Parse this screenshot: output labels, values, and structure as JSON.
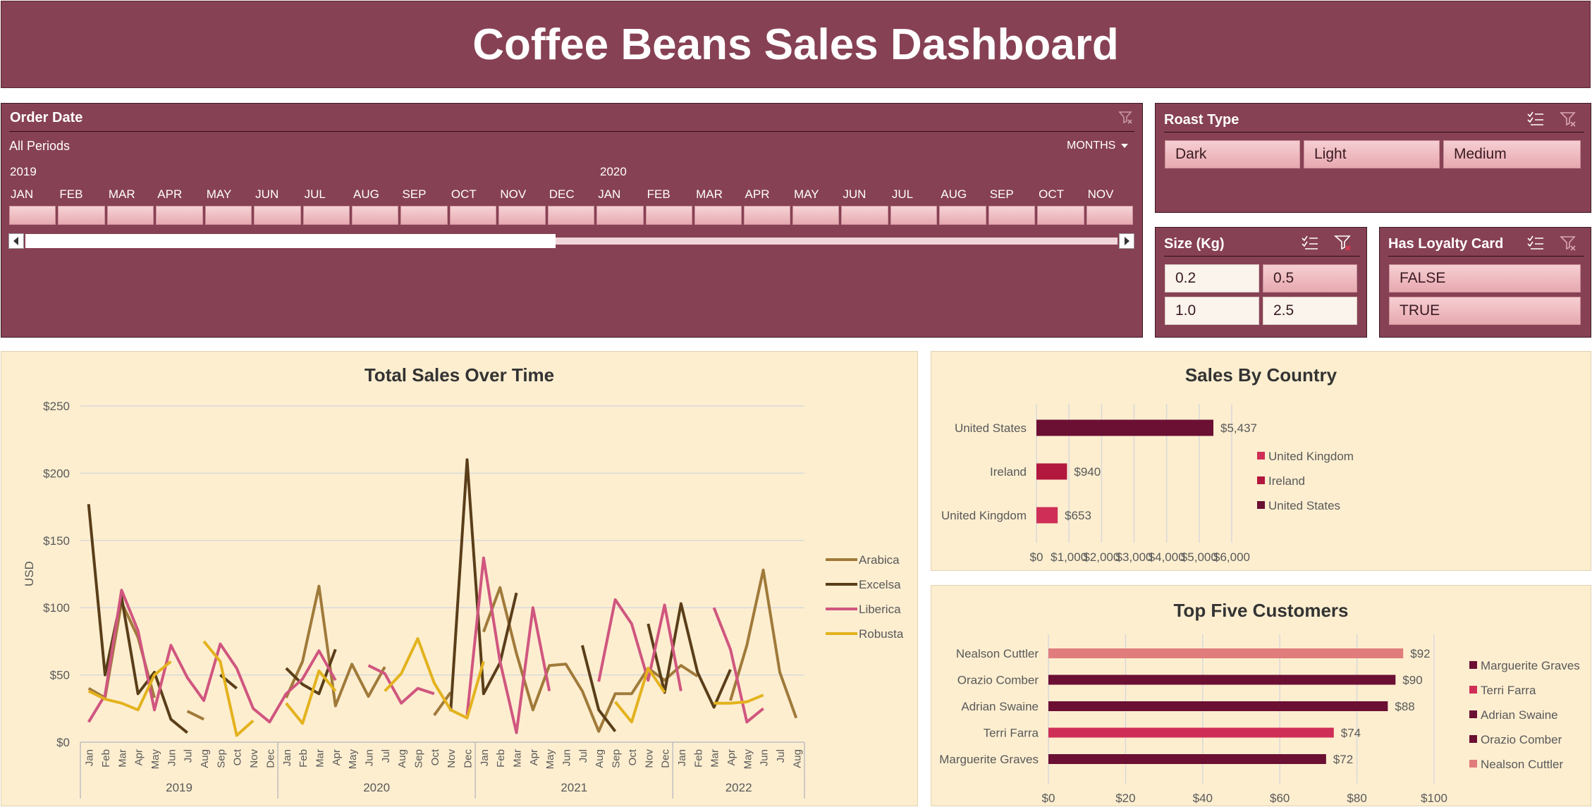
{
  "header": {
    "title": "Coffee Beans Sales Dashboard"
  },
  "timeline": {
    "title": "Order Date",
    "period_text": "All Periods",
    "level": "MONTHS",
    "years": [
      "2019",
      "2020"
    ],
    "months": [
      "JAN",
      "FEB",
      "MAR",
      "APR",
      "MAY",
      "JUN",
      "JUL",
      "AUG",
      "SEP",
      "OCT",
      "NOV",
      "DEC",
      "JAN",
      "FEB",
      "MAR",
      "APR",
      "MAY",
      "JUN",
      "JUL",
      "AUG",
      "SEP",
      "OCT",
      "NOV"
    ],
    "icon": "filter-clear-icon"
  },
  "roast": {
    "title": "Roast Type",
    "items": [
      "Dark",
      "Light",
      "Medium"
    ]
  },
  "size": {
    "title": "Size (Kg)",
    "items": [
      "0.2",
      "0.5",
      "1.0",
      "2.5"
    ]
  },
  "loyalty": {
    "title": "Has Loyalty Card",
    "items": [
      "FALSE",
      "TRUE"
    ]
  },
  "line_chart": {
    "title": "Total Sales Over Time",
    "ylabel": "USD",
    "yticks": [
      "$0",
      "$50",
      "$100",
      "$150",
      "$200",
      "$250"
    ],
    "year_labels": [
      "2019",
      "2020",
      "2021",
      "2022"
    ],
    "month_labels": [
      "Jan",
      "Feb",
      "Mar",
      "Apr",
      "May",
      "Jun",
      "Jul",
      "Aug",
      "Sep",
      "Oct",
      "Nov",
      "Dec"
    ],
    "last_year_months": 8
  },
  "country_chart": {
    "title": "Sales By Country",
    "categories": [
      "United States",
      "Ireland",
      "United Kingdom"
    ],
    "values": [
      5437,
      940,
      653
    ],
    "labels": [
      "$5,437",
      "$940",
      "$653"
    ],
    "colors": [
      "#6b0f33",
      "#b2173e",
      "#cf2f56"
    ],
    "xticks": [
      "$0",
      "$1,000",
      "$2,000",
      "$3,000",
      "$4,000",
      "$5,000",
      "$6,000"
    ],
    "legend": [
      "United Kingdom",
      "Ireland",
      "United States"
    ],
    "legend_colors": [
      "#cf2f56",
      "#b2173e",
      "#6b0f33"
    ]
  },
  "customer_chart": {
    "title": "Top Five Customers",
    "categories": [
      "Nealson Cuttler",
      "Orazio Comber",
      "Adrian Swaine",
      "Terri Farra",
      "Marguerite Graves"
    ],
    "values": [
      92,
      90,
      88,
      74,
      72
    ],
    "labels": [
      "$92",
      "$90",
      "$88",
      "$74",
      "$72"
    ],
    "colors": [
      "#e07d7c",
      "#6b0f33",
      "#6b0f33",
      "#cf2f56",
      "#6b0f33"
    ],
    "xticks": [
      "$0",
      "$20",
      "$40",
      "$60",
      "$80",
      "$100"
    ],
    "legend": [
      "Marguerite Graves",
      "Terri Farra",
      "Adrian Swaine",
      "Orazio Comber",
      "Nealson Cuttler"
    ],
    "legend_colors": [
      "#6b0f33",
      "#cf2f56",
      "#6b0f33",
      "#6b0f33",
      "#e07d7c"
    ]
  },
  "chart_data": [
    {
      "type": "line",
      "title": "Total Sales Over Time",
      "ylabel": "USD",
      "ylim": [
        0,
        250
      ],
      "x": [
        "2019-Jan",
        "2019-Feb",
        "2019-Mar",
        "2019-Apr",
        "2019-May",
        "2019-Jun",
        "2019-Jul",
        "2019-Aug",
        "2019-Sep",
        "2019-Oct",
        "2019-Nov",
        "2019-Dec",
        "2020-Jan",
        "2020-Feb",
        "2020-Mar",
        "2020-Apr",
        "2020-May",
        "2020-Jun",
        "2020-Jul",
        "2020-Aug",
        "2020-Sep",
        "2020-Oct",
        "2020-Nov",
        "2020-Dec",
        "2021-Jan",
        "2021-Feb",
        "2021-Mar",
        "2021-Apr",
        "2021-May",
        "2021-Jun",
        "2021-Jul",
        "2021-Aug",
        "2021-Sep",
        "2021-Oct",
        "2021-Nov",
        "2021-Dec",
        "2022-Jan",
        "2022-Feb",
        "2022-Mar",
        "2022-Apr",
        "2022-May",
        "2022-Jun",
        "2022-Jul",
        "2022-Aug"
      ],
      "series": [
        {
          "name": "Arabica",
          "color": "#a07a3a",
          "values": [
            40,
            33,
            104,
            78,
            33,
            null,
            23,
            17,
            null,
            null,
            null,
            null,
            33,
            60,
            116,
            27,
            58,
            34,
            56,
            null,
            null,
            20,
            37,
            null,
            82,
            115,
            66,
            24,
            57,
            58,
            38,
            8,
            36,
            36,
            55,
            46,
            57,
            49,
            null,
            31,
            72,
            128,
            52,
            18
          ]
        },
        {
          "name": "Excelsa",
          "color": "#5a3e19",
          "values": [
            177,
            50,
            108,
            36,
            52,
            17,
            7,
            null,
            50,
            40,
            null,
            null,
            55,
            43,
            36,
            69,
            null,
            null,
            null,
            null,
            null,
            null,
            23,
            210,
            36,
            59,
            111,
            null,
            null,
            null,
            72,
            24,
            8,
            null,
            88,
            37,
            103,
            52,
            26,
            54,
            null,
            null,
            null,
            null
          ]
        },
        {
          "name": "Liberica",
          "color": "#d0567f",
          "values": [
            15,
            35,
            113,
            83,
            24,
            72,
            48,
            31,
            73,
            55,
            25,
            15,
            36,
            47,
            68,
            46,
            null,
            57,
            51,
            29,
            40,
            36,
            null,
            20,
            137,
            60,
            7,
            100,
            38,
            null,
            null,
            45,
            106,
            88,
            46,
            102,
            38,
            null,
            100,
            69,
            15,
            25,
            null,
            null
          ]
        },
        {
          "name": "Robusta",
          "color": "#e3b21d",
          "values": [
            38,
            32,
            29,
            24,
            50,
            60,
            null,
            75,
            60,
            5,
            16,
            null,
            29,
            14,
            53,
            38,
            null,
            null,
            38,
            51,
            77,
            44,
            24,
            18,
            60,
            null,
            null,
            null,
            null,
            null,
            null,
            null,
            30,
            15,
            55,
            37,
            null,
            null,
            29,
            29,
            30,
            35,
            null,
            null
          ]
        }
      ]
    },
    {
      "type": "bar",
      "title": "Sales By Country",
      "categories": [
        "United States",
        "Ireland",
        "United Kingdom"
      ],
      "values": [
        5437,
        940,
        653
      ],
      "xlim": [
        0,
        6000
      ]
    },
    {
      "type": "bar",
      "title": "Top Five Customers",
      "categories": [
        "Nealson Cuttler",
        "Orazio Comber",
        "Adrian Swaine",
        "Terri Farra",
        "Marguerite Graves"
      ],
      "values": [
        92,
        90,
        88,
        74,
        72
      ],
      "xlim": [
        0,
        100
      ]
    }
  ]
}
